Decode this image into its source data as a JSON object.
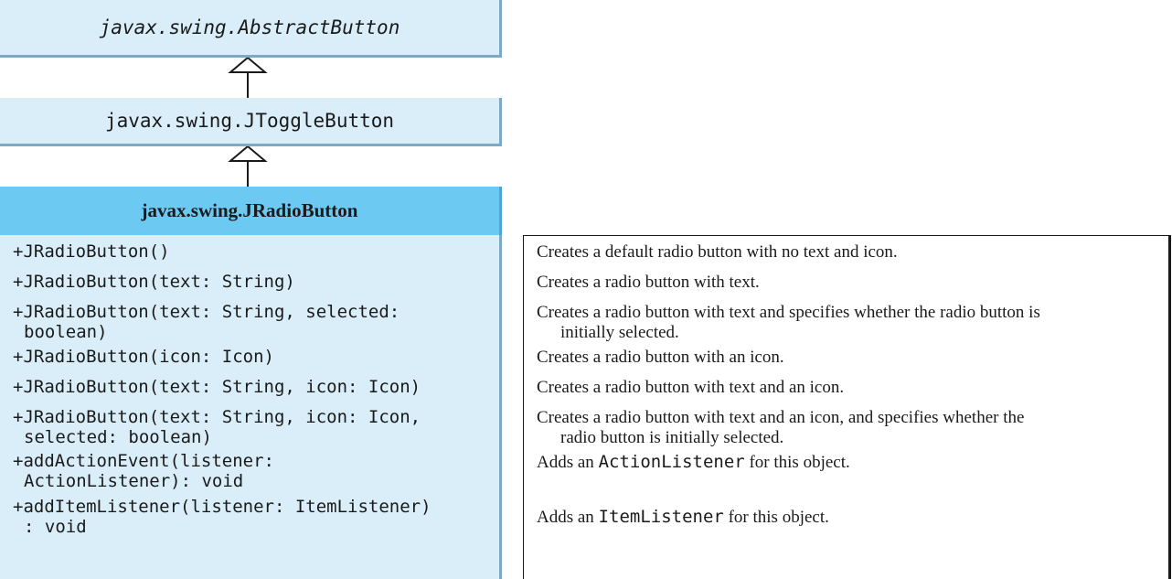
{
  "classes": {
    "abstract_button": "javax.swing.AbstractButton",
    "toggle_button": "javax.swing.JToggleButton",
    "radio_button": "javax.swing.JRadioButton"
  },
  "members": [
    {
      "line1": "+JRadioButton()",
      "line2": ""
    },
    {
      "line1": "+JRadioButton(text: String)",
      "line2": ""
    },
    {
      "line1": "+JRadioButton(text: String, selected:",
      "line2": "boolean)"
    },
    {
      "line1": "+JRadioButton(icon: Icon)",
      "line2": ""
    },
    {
      "line1": "+JRadioButton(text: String, icon: Icon)",
      "line2": ""
    },
    {
      "line1": "+JRadioButton(text: String, icon: Icon,",
      "line2": "selected: boolean)"
    },
    {
      "line1": "+addActionEvent(listener:",
      "line2": "ActionListener): void"
    },
    {
      "line1": "+addItemListener(listener: ItemListener)",
      "line2": ": void"
    }
  ],
  "descriptions": [
    {
      "line1": "Creates a default radio button with no text and icon.",
      "line2": ""
    },
    {
      "line1": "Creates a radio button with text.",
      "line2": ""
    },
    {
      "line1": "Creates a radio button with text and specifies whether the radio button is",
      "line2": "initially selected."
    },
    {
      "line1": "Creates a radio button with an icon.",
      "line2": ""
    },
    {
      "line1": "Creates a radio button with text and an icon.",
      "line2": ""
    },
    {
      "line1": "Creates a radio button with text and an icon, and specifies whether the",
      "line2": "radio button is initially selected."
    },
    {
      "pre": "Adds an ",
      "code": "ActionListener",
      "post": " for this object."
    },
    {
      "pre": "Adds an ",
      "code": "ItemListener",
      "post": " for this object."
    }
  ],
  "colors": {
    "class_fill": "#d9eef9",
    "header_fill": "#6cc9f1",
    "shadow": "#7ea9c4"
  }
}
